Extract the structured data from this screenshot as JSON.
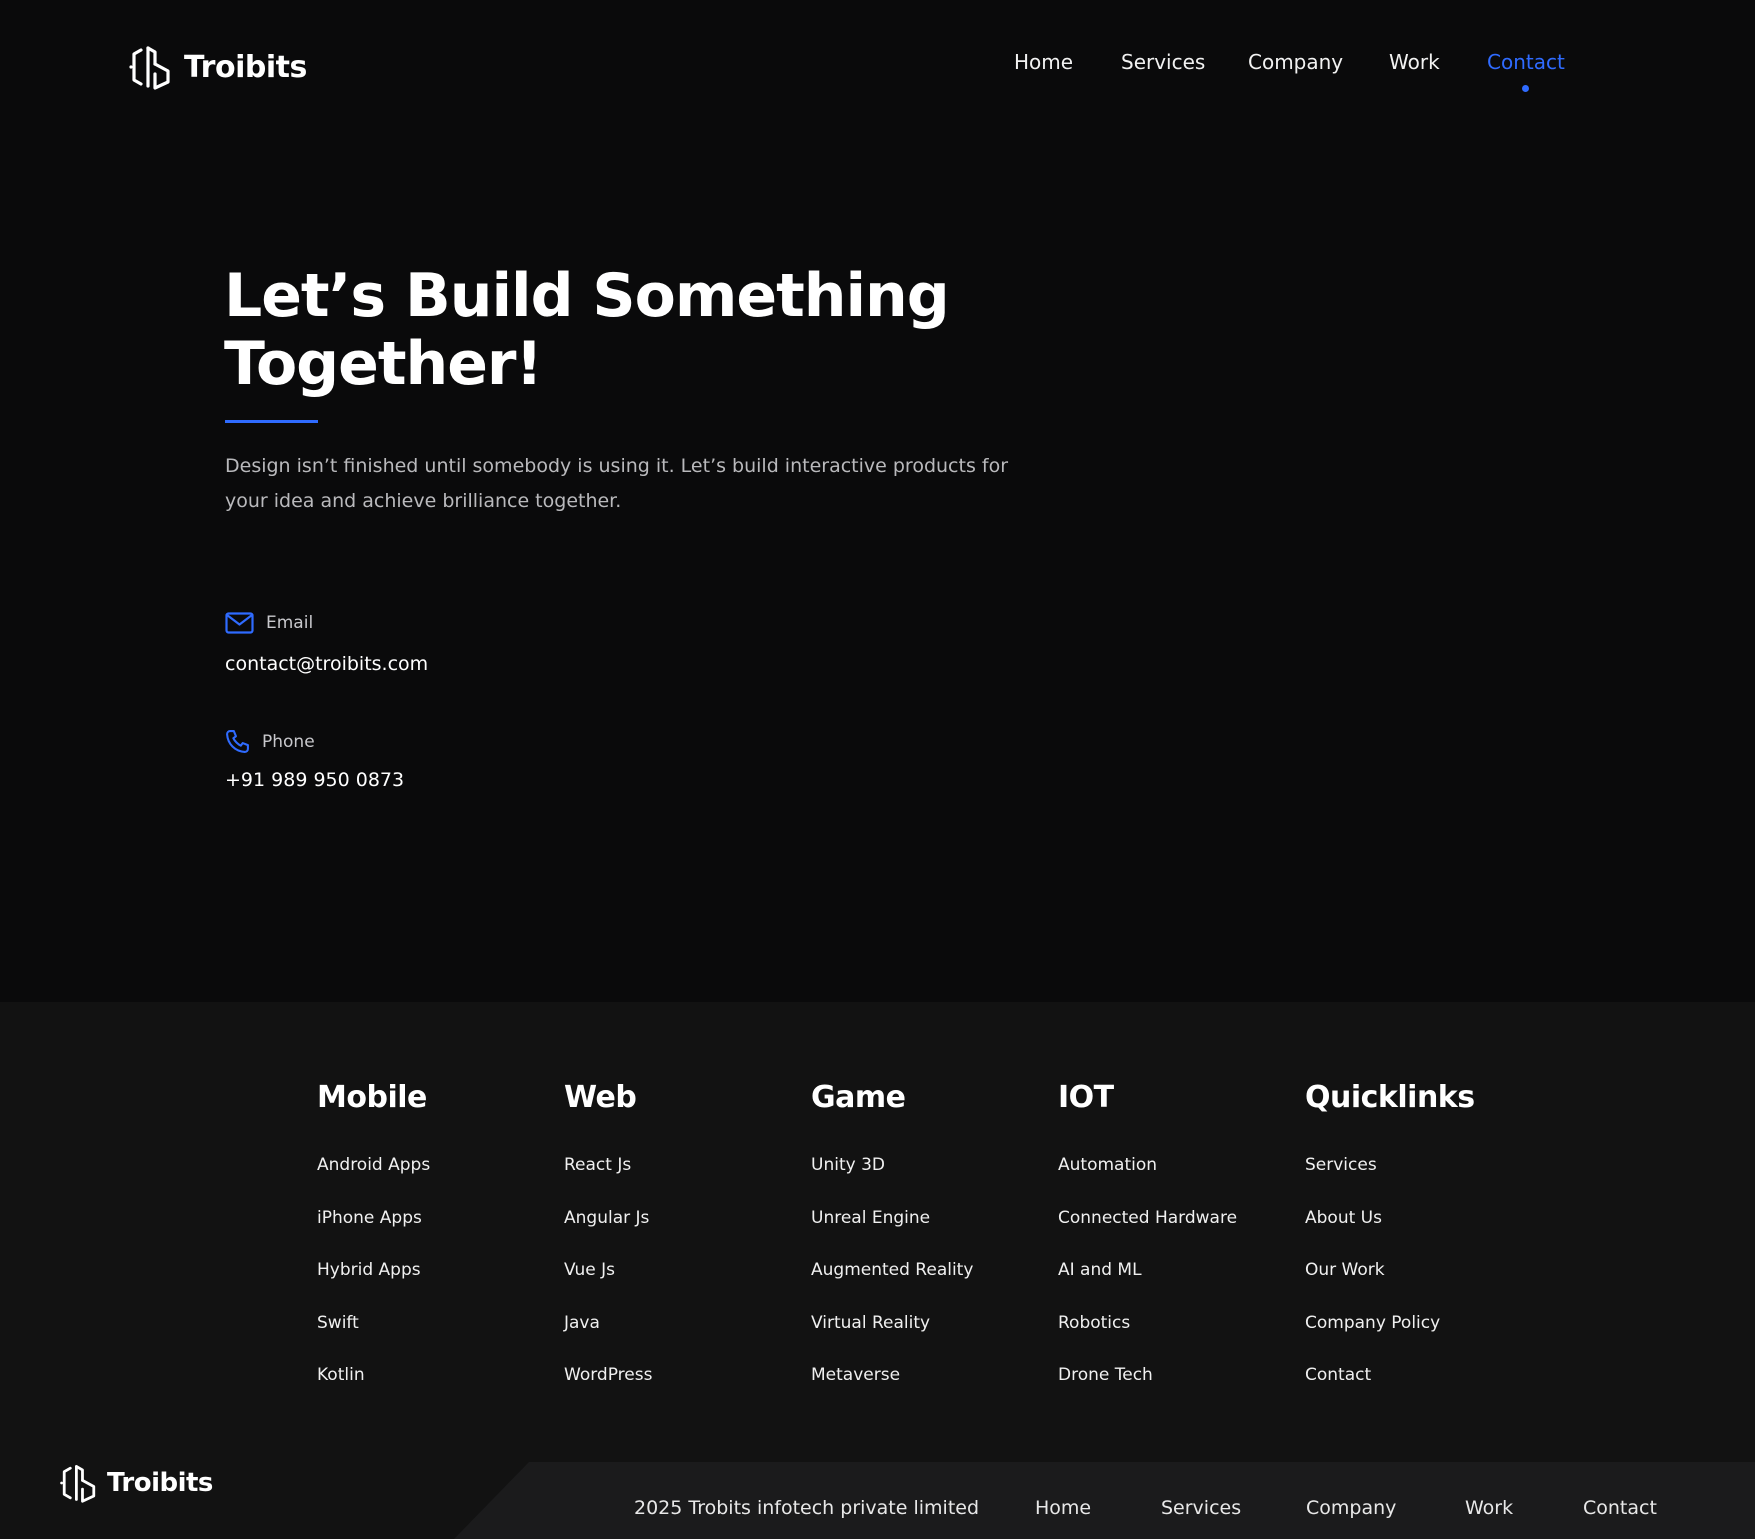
{
  "brand": {
    "name": "Troibits"
  },
  "nav": {
    "items": [
      "Home",
      "Services",
      "Company",
      "Work",
      "Contact"
    ],
    "active": "Contact"
  },
  "hero": {
    "title": "Let’s Build Something Together!",
    "description": "Design isn’t finished until somebody is using it. Let’s build interactive products for your idea and achieve brilliance together."
  },
  "contact": {
    "email_label": "Email",
    "email_value": "contact@troibits.com",
    "phone_label": "Phone",
    "phone_value": "+91 989 950 0873"
  },
  "footer": {
    "columns": [
      {
        "title": "Mobile",
        "items": [
          "Android Apps",
          "iPhone Apps",
          "Hybrid Apps",
          "Swift",
          "Kotlin"
        ]
      },
      {
        "title": "Web",
        "items": [
          "React Js",
          "Angular Js",
          "Vue Js",
          "Java",
          "WordPress"
        ]
      },
      {
        "title": "Game",
        "items": [
          "Unity 3D",
          "Unreal Engine",
          "Augmented Reality",
          "Virtual Reality",
          "Metaverse"
        ]
      },
      {
        "title": "IOT",
        "items": [
          "Automation",
          "Connected Hardware",
          "AI and ML",
          "Robotics",
          "Drone Tech"
        ]
      },
      {
        "title": "Quicklinks",
        "items": [
          "Services",
          "About Us",
          "Our Work",
          "Company Policy",
          "Contact"
        ]
      }
    ],
    "copyright": "2025 Trobits infotech private limited",
    "bottom_nav": [
      "Home",
      "Services",
      "Company",
      "Work",
      "Contact"
    ]
  },
  "colors": {
    "background": "#0a0a0b",
    "footer_background": "#121212",
    "accent": "#2f6bff",
    "text": "#ffffff",
    "muted_text": "#b9b9bc"
  },
  "icons": {
    "logo": "troibits-logo-icon",
    "email": "mail-icon",
    "phone": "phone-icon"
  }
}
